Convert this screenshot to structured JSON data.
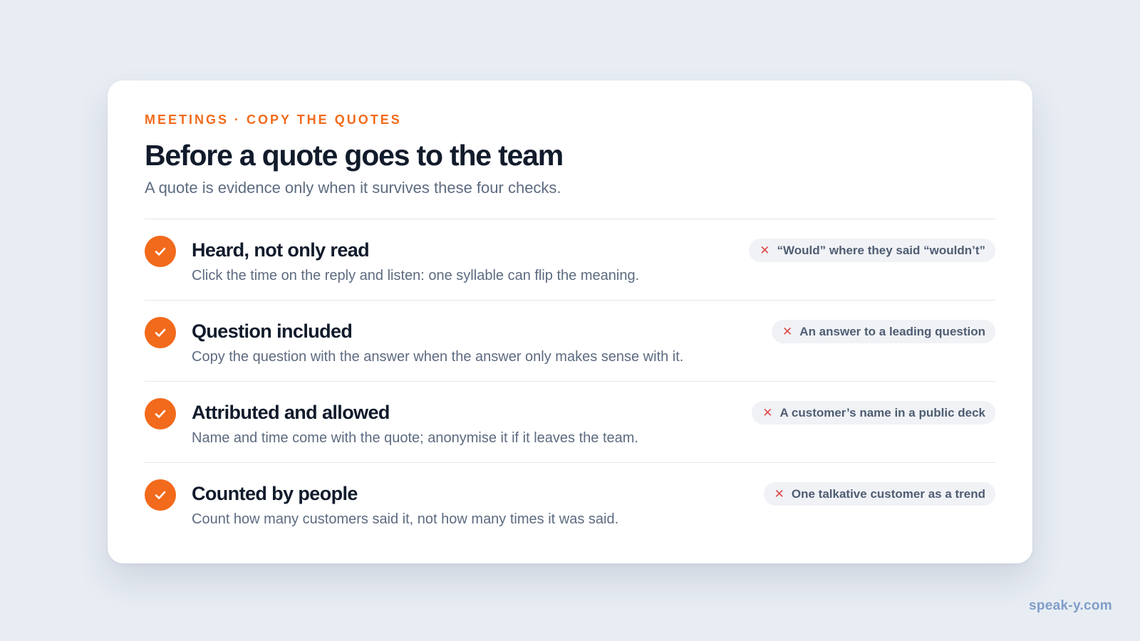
{
  "card": {
    "eyebrow": "MEETINGS · COPY THE QUOTES",
    "title": "Before a quote goes to the team",
    "subtitle": "A quote is evidence only when it survives these four checks."
  },
  "checks": [
    {
      "title": "Heard, not only read",
      "description": "Click the time on the reply and listen: one syllable can flip the meaning.",
      "pitfall": "“Would” where they said “wouldn’t”",
      "icon": "check-icon",
      "pitfall_icon": "x-icon"
    },
    {
      "title": "Question included",
      "description": "Copy the question with the answer when the answer only makes sense with it.",
      "pitfall": "An answer to a leading question",
      "icon": "check-icon",
      "pitfall_icon": "x-icon"
    },
    {
      "title": "Attributed and allowed",
      "description": "Name and time come with the quote; anonymise it if it leaves the team.",
      "pitfall": "A customer’s name in a public deck",
      "icon": "check-icon",
      "pitfall_icon": "x-icon"
    },
    {
      "title": "Counted by people",
      "description": "Count how many customers said it, not how many times it was said.",
      "pitfall": "One talkative customer as a trend",
      "icon": "check-icon",
      "pitfall_icon": "x-icon"
    }
  ],
  "footer": {
    "watermark": "speak-y.com"
  },
  "colors": {
    "accent": "#f26a1b",
    "background": "#e8edf4",
    "card": "#ffffff",
    "title": "#111b2b",
    "body": "#5d6b80",
    "pitfall_x": "#e04848",
    "pill_bg": "#f0f2f6",
    "watermark": "#7f9dc7"
  }
}
